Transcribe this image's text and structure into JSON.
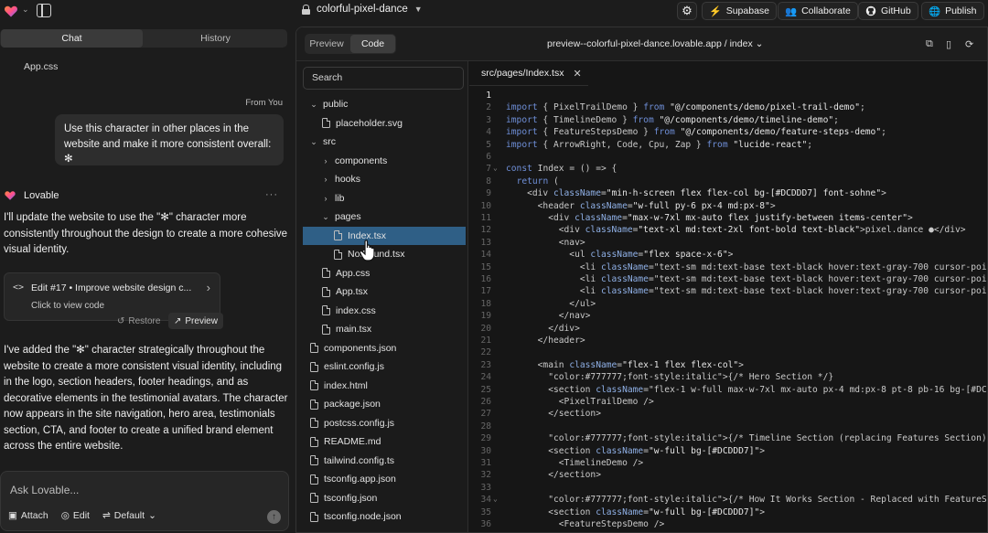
{
  "topbar": {
    "project_name": "colorful-pixel-dance",
    "buttons": {
      "supabase": "Supabase",
      "collaborate": "Collaborate",
      "github": "GitHub",
      "publish": "Publish"
    }
  },
  "chat": {
    "tabs": [
      "Chat",
      "History"
    ],
    "prev_file": "App.css",
    "from_you": "From You",
    "user_message": "Use this character in other places in the website and make it more consistent overall: ✻",
    "assistant_name": "Lovable",
    "assistant_intro": "I'll update the website to use the \"✻\" character more consistently throughout the design to create a more cohesive visual identity.",
    "edit_card": {
      "title": "Edit #17 • Improve website design c...",
      "subtitle": "Click to view code"
    },
    "restore_label": "Restore",
    "preview_label": "Preview",
    "assistant_summary": "I've added the \"✻\" character strategically throughout the website to create a more consistent visual identity, including in the logo, section headers, footer headings, and as decorative elements in the testimonial avatars. The character now appears in the site navigation, hero area, testimonials section, CTA, and footer to create a unified brand element across the entire website.",
    "input_placeholder": "Ask Lovable...",
    "input_tools": {
      "attach": "Attach",
      "edit": "Edit",
      "default": "Default"
    }
  },
  "editor": {
    "view_tabs": [
      "Preview",
      "Code"
    ],
    "url": "preview--colorful-pixel-dance.lovable.app / index",
    "search_placeholder": "Search",
    "tree": [
      {
        "label": "public",
        "type": "folder",
        "open": true,
        "depth": 0
      },
      {
        "label": "placeholder.svg",
        "type": "file",
        "depth": 1
      },
      {
        "label": "src",
        "type": "folder",
        "open": true,
        "depth": 0
      },
      {
        "label": "components",
        "type": "folder",
        "open": false,
        "depth": 1
      },
      {
        "label": "hooks",
        "type": "folder",
        "open": false,
        "depth": 1
      },
      {
        "label": "lib",
        "type": "folder",
        "open": false,
        "depth": 1
      },
      {
        "label": "pages",
        "type": "folder",
        "open": true,
        "depth": 1
      },
      {
        "label": "Index.tsx",
        "type": "file",
        "depth": 2,
        "selected": true
      },
      {
        "label": "NotFound.tsx",
        "type": "file",
        "depth": 2
      },
      {
        "label": "App.css",
        "type": "file",
        "depth": 1
      },
      {
        "label": "App.tsx",
        "type": "file",
        "depth": 1
      },
      {
        "label": "index.css",
        "type": "file",
        "depth": 1
      },
      {
        "label": "main.tsx",
        "type": "file",
        "depth": 1
      },
      {
        "label": "components.json",
        "type": "file",
        "depth": 0
      },
      {
        "label": "eslint.config.js",
        "type": "file",
        "depth": 0
      },
      {
        "label": "index.html",
        "type": "file",
        "depth": 0
      },
      {
        "label": "package.json",
        "type": "file",
        "depth": 0
      },
      {
        "label": "postcss.config.js",
        "type": "file",
        "depth": 0
      },
      {
        "label": "README.md",
        "type": "file",
        "depth": 0
      },
      {
        "label": "tailwind.config.ts",
        "type": "file",
        "depth": 0
      },
      {
        "label": "tsconfig.app.json",
        "type": "file",
        "depth": 0
      },
      {
        "label": "tsconfig.json",
        "type": "file",
        "depth": 0
      },
      {
        "label": "tsconfig.node.json",
        "type": "file",
        "depth": 0
      }
    ],
    "open_file": "src/pages/Index.tsx",
    "code_lines": [
      "",
      "import { PixelTrailDemo } from \"@/components/demo/pixel-trail-demo\";",
      "import { TimelineDemo } from \"@/components/demo/timeline-demo\";",
      "import { FeatureStepsDemo } from \"@/components/demo/feature-steps-demo\";",
      "import { ArrowRight, Code, Cpu, Zap } from \"lucide-react\";",
      "",
      "const Index = () => {",
      "  return (",
      "    <div className=\"min-h-screen flex flex-col bg-[#DCDDD7] font-sohne\">",
      "      <header className=\"w-full py-6 px-4 md:px-8\">",
      "        <div className=\"max-w-7xl mx-auto flex justify-between items-center\">",
      "          <div className=\"text-xl md:text-2xl font-bold text-black\">pixel.dance ●</div>",
      "          <nav>",
      "            <ul className=\"flex space-x-6\">",
      "              <li className=\"text-sm md:text-base text-black hover:text-gray-700 cursor-poi",
      "              <li className=\"text-sm md:text-base text-black hover:text-gray-700 cursor-poi",
      "              <li className=\"text-sm md:text-base text-black hover:text-gray-700 cursor-poi",
      "            </ul>",
      "          </nav>",
      "        </div>",
      "      </header>",
      "",
      "      <main className=\"flex-1 flex flex-col\">",
      "        {/* Hero Section */}",
      "        <section className=\"flex-1 w-full max-w-7xl mx-auto px-4 md:px-8 pt-8 pb-16 bg-[#DC",
      "          <PixelTrailDemo />",
      "        </section>",
      "",
      "        {/* Timeline Section (replacing Features Section) */}",
      "        <section className=\"w-full bg-[#DCDDD7]\">",
      "          <TimelineDemo />",
      "        </section>",
      "",
      "        {/* How It Works Section - Replaced with FeatureStepsDemo */}",
      "        <section className=\"w-full bg-[#DCDDD7]\">",
      "          <FeatureStepsDemo />"
    ],
    "folded_lines": [
      7,
      34
    ],
    "colors": {
      "keyword": "#6f8fd8",
      "string": "#e6e6e6",
      "tag": "#e0e0e0",
      "attr": "#8fb0e6",
      "comment": "#777777",
      "selection": "#2f5f86"
    }
  }
}
